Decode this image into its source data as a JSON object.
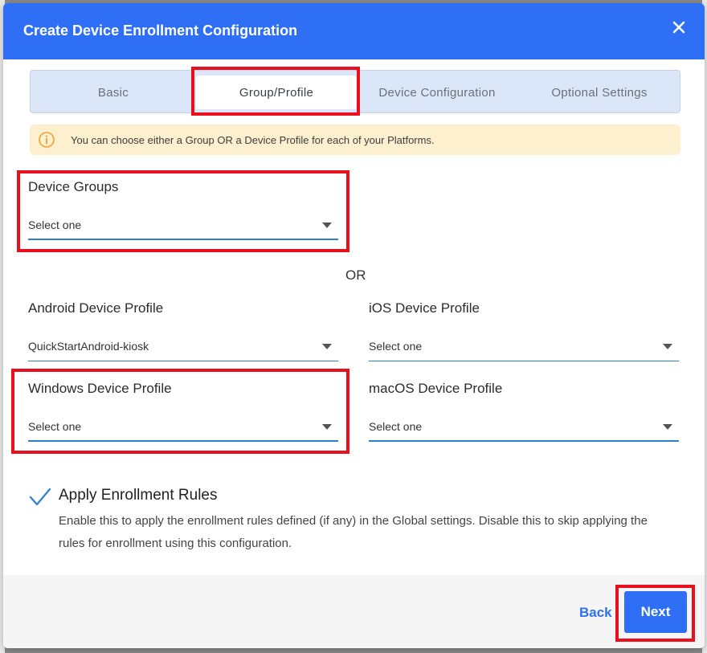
{
  "modal": {
    "title": "Create Device Enrollment Configuration"
  },
  "stepper": {
    "steps": [
      {
        "label": "Basic",
        "active": false
      },
      {
        "label": "Group/Profile",
        "active": true
      },
      {
        "label": "Device Configuration",
        "active": false
      },
      {
        "label": "Optional Settings",
        "active": false
      }
    ]
  },
  "info_banner": {
    "icon": "info-icon",
    "text": "You can choose either a Group OR a Device Profile for each of your Platforms."
  },
  "device_groups": {
    "label": "Device Groups",
    "value": "Select one"
  },
  "or_text": "OR",
  "profiles": {
    "android": {
      "label": "Android Device Profile",
      "value": "QuickStartAndroid-kiosk"
    },
    "ios": {
      "label": "iOS Device Profile",
      "value": "Select one"
    },
    "windows": {
      "label": "Windows Device Profile",
      "value": "Select one"
    },
    "macos": {
      "label": "macOS Device Profile",
      "value": "Select one"
    }
  },
  "enrollment_rules": {
    "checked": true,
    "title": "Apply Enrollment Rules",
    "description": "Enable this to apply the enrollment rules defined (if any) in the Global settings. Disable this to skip applying the rules for enrollment using this configuration."
  },
  "footer": {
    "back_label": "Back",
    "next_label": "Next"
  },
  "colors": {
    "primary": "#2f6ff5",
    "highlight": "#e8101c",
    "banner_bg": "#fdf0cf",
    "stepper_bg": "#dbe7f8"
  }
}
